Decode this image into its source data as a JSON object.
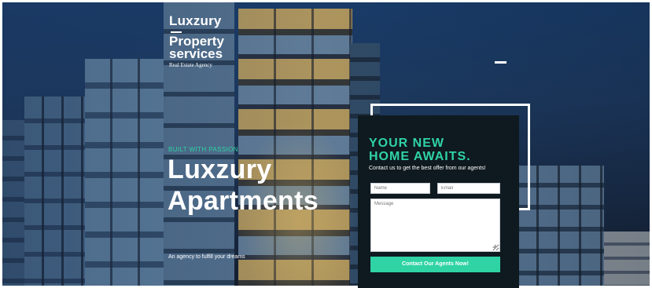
{
  "brand": {
    "logo_top": "Luxzury",
    "logo_name_line1": "Property",
    "logo_name_line2": "services",
    "logo_sub": "Real Estate Agency"
  },
  "nav": {
    "menu_icon": "menu-icon"
  },
  "hero": {
    "tagline": "BUILT WITH PASSION",
    "headline_line1": "Luxzury",
    "headline_line2": "Apartments",
    "subline": "An agency to fulfill your dreams"
  },
  "form": {
    "title_line1": "YOUR NEW",
    "title_line2": "HOME AWAITS.",
    "description": "Contact us to get the best offer from our agents!",
    "name_placeholder": "Name",
    "email_placeholder": "Email",
    "message_placeholder": "Message",
    "submit_label": "Contact Our Agents Now!"
  },
  "colors": {
    "accent": "#2fd3a4",
    "card_bg": "#0f1a20",
    "text": "#ffffff"
  }
}
